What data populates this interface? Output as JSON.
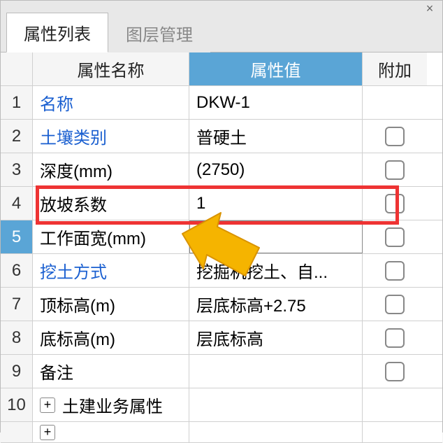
{
  "tabs": {
    "active": "属性列表",
    "inactive": "图层管理"
  },
  "headers": {
    "name": "属性名称",
    "value": "属性值",
    "ext": "附加"
  },
  "rows": [
    {
      "n": "1",
      "name": "名称",
      "value": "DKW-1",
      "link": true,
      "cb": false
    },
    {
      "n": "2",
      "name": "土壤类别",
      "value": "普硬土",
      "link": true,
      "cb": true
    },
    {
      "n": "3",
      "name": "深度(mm)",
      "value": "(2750)",
      "link": false,
      "cb": true
    },
    {
      "n": "4",
      "name": "放坡系数",
      "value": "1",
      "link": false,
      "cb": true
    },
    {
      "n": "5",
      "name": "工作面宽(mm)",
      "value": "",
      "link": false,
      "cb": true,
      "sel": true
    },
    {
      "n": "6",
      "name": "挖土方式",
      "value": "挖掘机挖土、自...",
      "link": true,
      "cb": true
    },
    {
      "n": "7",
      "name": "顶标高(m)",
      "value": "层底标高+2.75",
      "link": false,
      "cb": true
    },
    {
      "n": "8",
      "name": "底标高(m)",
      "value": "层底标高",
      "link": false,
      "cb": true
    },
    {
      "n": "9",
      "name": "备注",
      "value": "",
      "link": false,
      "cb": true
    },
    {
      "n": "10",
      "name": "土建业务属性",
      "value": "",
      "link": false,
      "cb": false,
      "expand": true
    }
  ],
  "partial": {
    "n": ""
  }
}
